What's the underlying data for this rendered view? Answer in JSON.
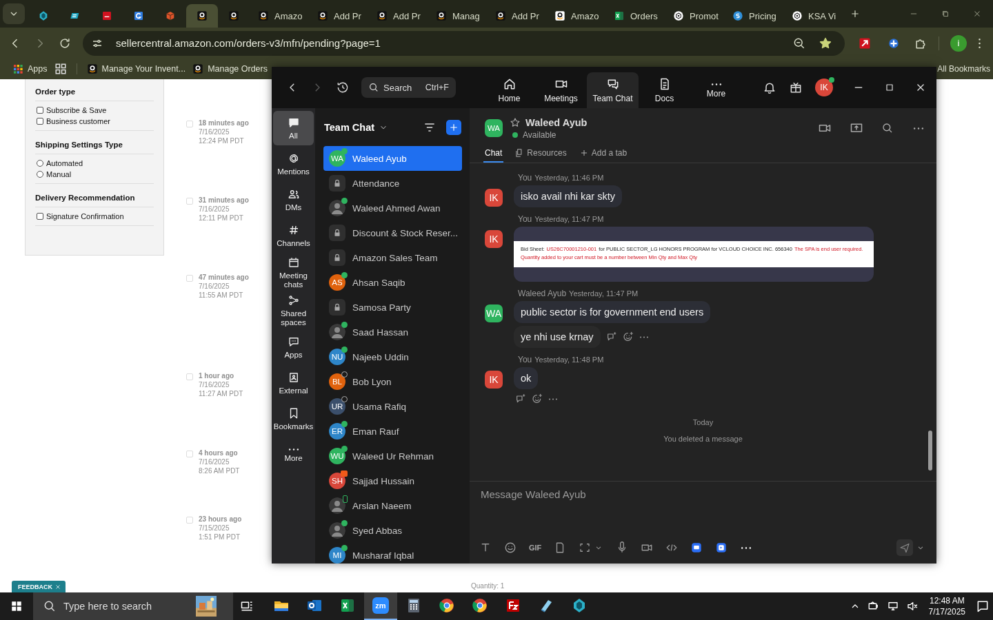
{
  "browser": {
    "tabs": [
      {
        "kind": "diamond",
        "selected": false
      },
      {
        "kind": "ec",
        "selected": false
      },
      {
        "kind": "dh",
        "selected": false
      },
      {
        "kind": "g",
        "selected": false
      },
      {
        "kind": "box",
        "selected": false
      },
      {
        "kind": "amazon",
        "selected": true
      },
      {
        "kind": "amazon",
        "selected": false
      },
      {
        "kind": "amazon",
        "title": "Amazo",
        "selected": false
      },
      {
        "kind": "amazon",
        "title": "Add Pr",
        "selected": false
      },
      {
        "kind": "amazon",
        "title": "Add Pr",
        "selected": false
      },
      {
        "kind": "amazon",
        "title": "Manag",
        "selected": false
      },
      {
        "kind": "amazon",
        "title": "Add Pr",
        "selected": false
      },
      {
        "kind": "amazon-light",
        "title": "Amazo",
        "selected": false
      },
      {
        "kind": "excel",
        "title": "Orders",
        "selected": false
      },
      {
        "kind": "openai",
        "title": "Promot",
        "selected": false
      },
      {
        "kind": "pricing",
        "title": "Pricing",
        "selected": false
      },
      {
        "kind": "openai",
        "title": "KSA Vi",
        "selected": false
      }
    ],
    "address": "sellercentral.amazon.com/orders-v3/mfn/pending?page=1",
    "profile_initial": "i",
    "bookmarks": [
      {
        "kind": "apps",
        "label": "Apps"
      },
      {
        "kind": "grid"
      },
      {
        "kind": "amazon",
        "label": "Manage Your Invent..."
      },
      {
        "kind": "amazon",
        "label": "Manage Orders"
      }
    ],
    "all_bookmarks": "All Bookmarks"
  },
  "page": {
    "filters": [
      {
        "title": "Order type",
        "options": [
          {
            "kind": "checkbox",
            "label": "Subscribe & Save",
            "checked": false
          },
          {
            "kind": "checkbox",
            "label": "Business customer",
            "checked": false
          }
        ]
      },
      {
        "title": "Shipping Settings Type",
        "options": [
          {
            "kind": "radio",
            "label": "Automated",
            "checked": false
          },
          {
            "kind": "radio",
            "label": "Manual",
            "checked": false
          }
        ]
      },
      {
        "title": "Delivery Recommendation",
        "options": [
          {
            "kind": "checkbox",
            "label": "Signature Confirmation",
            "checked": false
          }
        ]
      }
    ],
    "orders": [
      {
        "age": "18 minutes ago",
        "date": "7/16/2025",
        "time": "12:24 PM PDT",
        "checked": false
      },
      {
        "age": "31 minutes ago",
        "date": "7/16/2025",
        "time": "12:11 PM PDT",
        "checked": false
      },
      {
        "age": "47 minutes ago",
        "date": "7/16/2025",
        "time": "11:55 AM PDT",
        "checked": false
      },
      {
        "age": "1 hour ago",
        "date": "7/16/2025",
        "time": "11:27 AM PDT",
        "checked": false
      },
      {
        "age": "4 hours ago",
        "date": "7/16/2025",
        "time": "8:26 AM PDT",
        "checked": false
      },
      {
        "age": "23 hours ago",
        "date": "7/15/2025",
        "time": "1:51 PM PDT",
        "checked": false
      }
    ],
    "quantity": "Quantity: 1",
    "feedback": "FEEDBACK"
  },
  "zoom": {
    "search": {
      "placeholder": "Search",
      "shortcut": "Ctrl+F"
    },
    "nav": [
      {
        "kind": "home",
        "label": "Home",
        "selected": false
      },
      {
        "kind": "video",
        "label": "Meetings",
        "selected": false
      },
      {
        "kind": "chats",
        "label": "Team Chat",
        "selected": true
      },
      {
        "kind": "doc",
        "label": "Docs",
        "selected": false
      },
      {
        "kind": "dots",
        "label": "More",
        "selected": false
      }
    ],
    "user_initials": "IK",
    "rail": [
      {
        "kind": "chat",
        "label": "All",
        "selected": true
      },
      {
        "kind": "at",
        "label": "Mentions",
        "selected": false
      },
      {
        "kind": "people",
        "label": "DMs",
        "selected": false
      },
      {
        "kind": "hash",
        "label": "Channels",
        "selected": false
      },
      {
        "kind": "calendar",
        "label": "Meeting chats",
        "selected": false
      },
      {
        "kind": "share",
        "label": "Shared spaces",
        "selected": false
      },
      {
        "kind": "chatdots",
        "label": "Apps",
        "selected": false
      },
      {
        "kind": "badge",
        "label": "External",
        "selected": false
      },
      {
        "kind": "bookmark",
        "label": "Bookmarks",
        "selected": false
      },
      {
        "kind": "dots",
        "label": "More",
        "selected": false
      }
    ],
    "list_title": "Team Chat",
    "chats": [
      {
        "name": "Waleed Ayub",
        "kind": "initials",
        "initials": "WA",
        "color": "#2fb45f",
        "presence": {
          "kind": "online"
        },
        "selected": true
      },
      {
        "name": "Attendance",
        "kind": "channel",
        "selected": false
      },
      {
        "name": "Waleed Ahmed Awan",
        "presence": {
          "kind": "online"
        },
        "selected": false
      },
      {
        "name": "Discount & Stock Reser...",
        "kind": "channel",
        "selected": false
      },
      {
        "name": "Amazon Sales Team",
        "kind": "channel",
        "selected": false
      },
      {
        "name": "Ahsan Saqib",
        "kind": "initials",
        "initials": "AS",
        "color": "#e0620d",
        "presence": {
          "kind": "online"
        },
        "selected": false
      },
      {
        "name": "Samosa Party",
        "kind": "channel",
        "selected": false
      },
      {
        "name": "Saad Hassan",
        "presence": {
          "kind": "online"
        },
        "selected": false
      },
      {
        "name": "Najeeb Uddin",
        "kind": "initials",
        "initials": "NU",
        "color": "#2e86c9",
        "presence": {
          "kind": "online"
        },
        "selected": false
      },
      {
        "name": "Bob Lyon",
        "kind": "initials",
        "initials": "BL",
        "color": "#e0620d",
        "presence": {
          "kind": "offline"
        },
        "selected": false
      },
      {
        "name": "Usama Rafiq",
        "kind": "initials",
        "initials": "UR",
        "color": "#3b4f6b",
        "presence": {
          "kind": "offline"
        },
        "selected": false
      },
      {
        "name": "Eman Rauf",
        "kind": "initials",
        "initials": "ER",
        "color": "#2e86c9",
        "presence": {
          "kind": "online"
        },
        "selected": false
      },
      {
        "name": "Waleed Ur Rehman",
        "kind": "initials",
        "initials": "WU",
        "color": "#2fb45f",
        "presence": {
          "kind": "online"
        },
        "selected": false
      },
      {
        "name": "Sajjad Hussain",
        "kind": "initials",
        "initials": "SH",
        "color": "#d9473a",
        "presence": {
          "kind": "meeting"
        },
        "selected": false
      },
      {
        "name": "Arslan Naeem",
        "presence": {
          "kind": "mobile"
        },
        "selected": false
      },
      {
        "name": "Syed Abbas",
        "presence": {
          "kind": "online"
        },
        "selected": false
      },
      {
        "name": "Musharaf Iqbal",
        "kind": "initials",
        "initials": "MI",
        "color": "#2e86c9",
        "presence": {
          "kind": "online"
        },
        "selected": false
      }
    ],
    "conversation": {
      "initials": "WA",
      "color": "#2fb45f",
      "name": "Waleed Ayub",
      "status": "Available",
      "tabs": [
        {
          "kind": "none",
          "label": "Chat",
          "selected": true
        },
        {
          "kind": "resources",
          "label": "Resources",
          "selected": false
        },
        {
          "kind": "plus",
          "label": "Add a tab",
          "selected": false
        }
      ],
      "messages": [
        {
          "kind": "group",
          "sender": "You",
          "time": "Yesterday, 11:46 PM",
          "initials": "IK",
          "color": "#d9473a",
          "actions_below": false,
          "bubbles": [
            {
              "kind": "text",
              "text": "isko avail nhi kar skty",
              "actions": false
            }
          ]
        },
        {
          "kind": "group",
          "sender": "You",
          "time": "Yesterday, 11:47 PM",
          "initials": "IK",
          "color": "#d9473a",
          "actions_below": false,
          "bubbles": [
            {
              "actions": false,
              "lines": [
                [
                  {
                    "kind": "plain",
                    "text": "Bid Sheet:"
                  },
                  {
                    "kind": "alert",
                    "text": "US26C70001210-001"
                  },
                  {
                    "kind": "plain",
                    "text": "for PUBLIC SECTOR_LG HONORS PROGRAM for VCLOUD CHOICE INC. 656340"
                  },
                  {
                    "kind": "alert",
                    "text": "The SPA is end user required."
                  }
                ],
                [
                  {
                    "kind": "alert",
                    "text": "Quantity added to your cart must be a number between Min Qty and Max Qty"
                  }
                ]
              ]
            }
          ]
        },
        {
          "kind": "group",
          "sender": "Waleed Ayub",
          "time": "Yesterday, 11:47 PM",
          "initials": "WA",
          "color": "#2fb45f",
          "actions_below": false,
          "bubbles": [
            {
              "kind": "text",
              "text": "public sector is for government end users",
              "actions": false
            },
            {
              "kind": "text",
              "text": "ye nhi use krnay",
              "actions": true
            }
          ]
        },
        {
          "kind": "group",
          "sender": "You",
          "time": "Yesterday, 11:48 PM",
          "initials": "IK",
          "color": "#d9473a",
          "actions_below": true,
          "bubbles": [
            {
              "kind": "text",
              "text": "ok",
              "actions": false
            }
          ]
        },
        {
          "kind": "divider",
          "text": "Today"
        },
        {
          "kind": "note",
          "text": "You deleted a message"
        }
      ],
      "composer": {
        "placeholder": "Message Waleed Ayub",
        "tools": [
          {
            "kind": "format"
          },
          {
            "kind": "emoji"
          },
          {
            "kind": "gif",
            "label": "GIF"
          },
          {
            "kind": "file"
          },
          {
            "kind": "screenshot"
          },
          {
            "kind": "caret"
          },
          {
            "kind": "mic"
          },
          {
            "kind": "camera"
          },
          {
            "kind": "code"
          },
          {
            "kind": "app"
          },
          {
            "kind": "app2"
          },
          {
            "kind": "more"
          }
        ]
      }
    }
  },
  "taskbar": {
    "search": {
      "placeholder": "Type here to search"
    },
    "apps": [
      {
        "kind": "folder",
        "selected": false
      },
      {
        "kind": "outlook",
        "selected": false
      },
      {
        "kind": "excel",
        "selected": false
      },
      {
        "kind": "zoom",
        "label": "zm",
        "selected": true
      },
      {
        "kind": "calc",
        "selected": false
      },
      {
        "kind": "chrome",
        "selected": false
      },
      {
        "kind": "chrome",
        "selected": false
      },
      {
        "kind": "filezilla",
        "selected": false
      },
      {
        "kind": "notepad",
        "selected": false
      },
      {
        "kind": "diamond",
        "selected": false
      }
    ],
    "time": "12:48 AM",
    "date": "7/17/2025"
  }
}
